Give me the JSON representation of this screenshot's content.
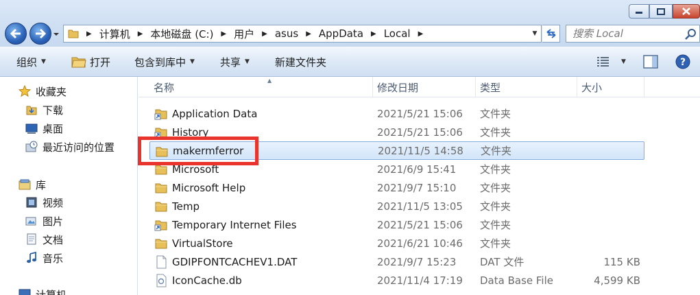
{
  "window": {
    "minimize_icon": "minimize-icon",
    "maximize_icon": "maximize-icon",
    "close_icon": "close-icon"
  },
  "address": {
    "breadcrumbs": [
      "计算机",
      "本地磁盘 (C:)",
      "用户",
      "asus",
      "AppData",
      "Local"
    ]
  },
  "search": {
    "placeholder": "搜索 Local"
  },
  "toolbar": {
    "organize": "组织",
    "open": "打开",
    "include_in_library": "包含到库中",
    "share": "共享",
    "new_folder": "新建文件夹"
  },
  "nav": {
    "favorites": "收藏夹",
    "downloads": "下载",
    "desktop": "桌面",
    "recent_places": "最近访问的位置",
    "libraries": "库",
    "videos": "视频",
    "pictures": "图片",
    "documents": "文档",
    "music": "音乐",
    "computer": "计算机"
  },
  "columns": {
    "name": "名称",
    "date": "修改日期",
    "type": "类型",
    "size": "大小"
  },
  "files": [
    {
      "name": "Application Data",
      "date": "2021/5/21 15:06",
      "type": "文件夹",
      "size": "",
      "icon": "folder-shortcut-icon"
    },
    {
      "name": "History",
      "date": "2021/5/21 15:06",
      "type": "文件夹",
      "size": "",
      "icon": "folder-shortcut-icon"
    },
    {
      "name": "makermferror",
      "date": "2021/11/5 14:58",
      "type": "文件夹",
      "size": "",
      "icon": "folder-icon",
      "selected": true
    },
    {
      "name": "Microsoft",
      "date": "2021/6/9 15:41",
      "type": "文件夹",
      "size": "",
      "icon": "folder-icon"
    },
    {
      "name": "Microsoft Help",
      "date": "2021/9/7 15:10",
      "type": "文件夹",
      "size": "",
      "icon": "folder-icon"
    },
    {
      "name": "Temp",
      "date": "2021/11/5 13:05",
      "type": "文件夹",
      "size": "",
      "icon": "folder-icon"
    },
    {
      "name": "Temporary Internet Files",
      "date": "2021/5/21 15:06",
      "type": "文件夹",
      "size": "",
      "icon": "folder-shortcut-icon"
    },
    {
      "name": "VirtualStore",
      "date": "2021/6/21 10:46",
      "type": "文件夹",
      "size": "",
      "icon": "folder-icon"
    },
    {
      "name": "GDIPFONTCACHEV1.DAT",
      "date": "2021/9/7 15:23",
      "type": "DAT 文件",
      "size": "115 KB",
      "icon": "file-icon"
    },
    {
      "name": "IconCache.db",
      "date": "2021/11/4 17:19",
      "type": "Data Base File",
      "size": "4,599 KB",
      "icon": "db-file-icon"
    }
  ],
  "colors": {
    "annotation": "#e8342c",
    "selection": "#d2e5fa",
    "folder": "#e8c05a"
  }
}
